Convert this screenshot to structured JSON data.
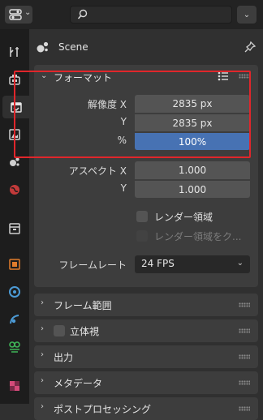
{
  "header": {
    "search": {
      "value": "",
      "placeholder": ""
    }
  },
  "context": {
    "scene_label": "Scene"
  },
  "format_panel": {
    "title": "フォーマット",
    "resolution_x_label": "解像度 X",
    "resolution_x_value": "2835 px",
    "resolution_y_label": "Y",
    "resolution_y_value": "2835 px",
    "percent_label": "%",
    "percent_value": "100%",
    "percent_fraction": 1.0,
    "aspect_x_label": "アスペクト X",
    "aspect_x_value": "1.000",
    "aspect_y_label": "Y",
    "aspect_y_value": "1.000",
    "render_region_label": "レンダー領域",
    "render_region_checked": false,
    "crop_label": "レンダー領域をク...",
    "crop_checked": false,
    "framerate_label": "フレームレート",
    "framerate_value": "24 FPS"
  },
  "collapsed_panels": [
    {
      "label": "フレーム範囲"
    },
    {
      "label": "立体視"
    },
    {
      "label": "出力"
    },
    {
      "label": "メタデータ"
    },
    {
      "label": "ポストプロセッシング"
    }
  ],
  "icons": {
    "editor_type": "properties-editor-icon",
    "search": "search-icon",
    "pin": "pin-icon",
    "scene": "scene-icon",
    "tabs": [
      "tool-icon",
      "render-icon",
      "output-icon",
      "view-layer-icon",
      "scene-icon",
      "world-icon",
      "collection-icon",
      "object-icon",
      "modifier-icon",
      "particles-icon",
      "physics-icon",
      "texture-icon"
    ]
  },
  "colors": {
    "highlight": "#e0262b",
    "slider_fill": "#4772b3",
    "panel_bg": "#3d3d3d",
    "field_bg": "#545454"
  }
}
